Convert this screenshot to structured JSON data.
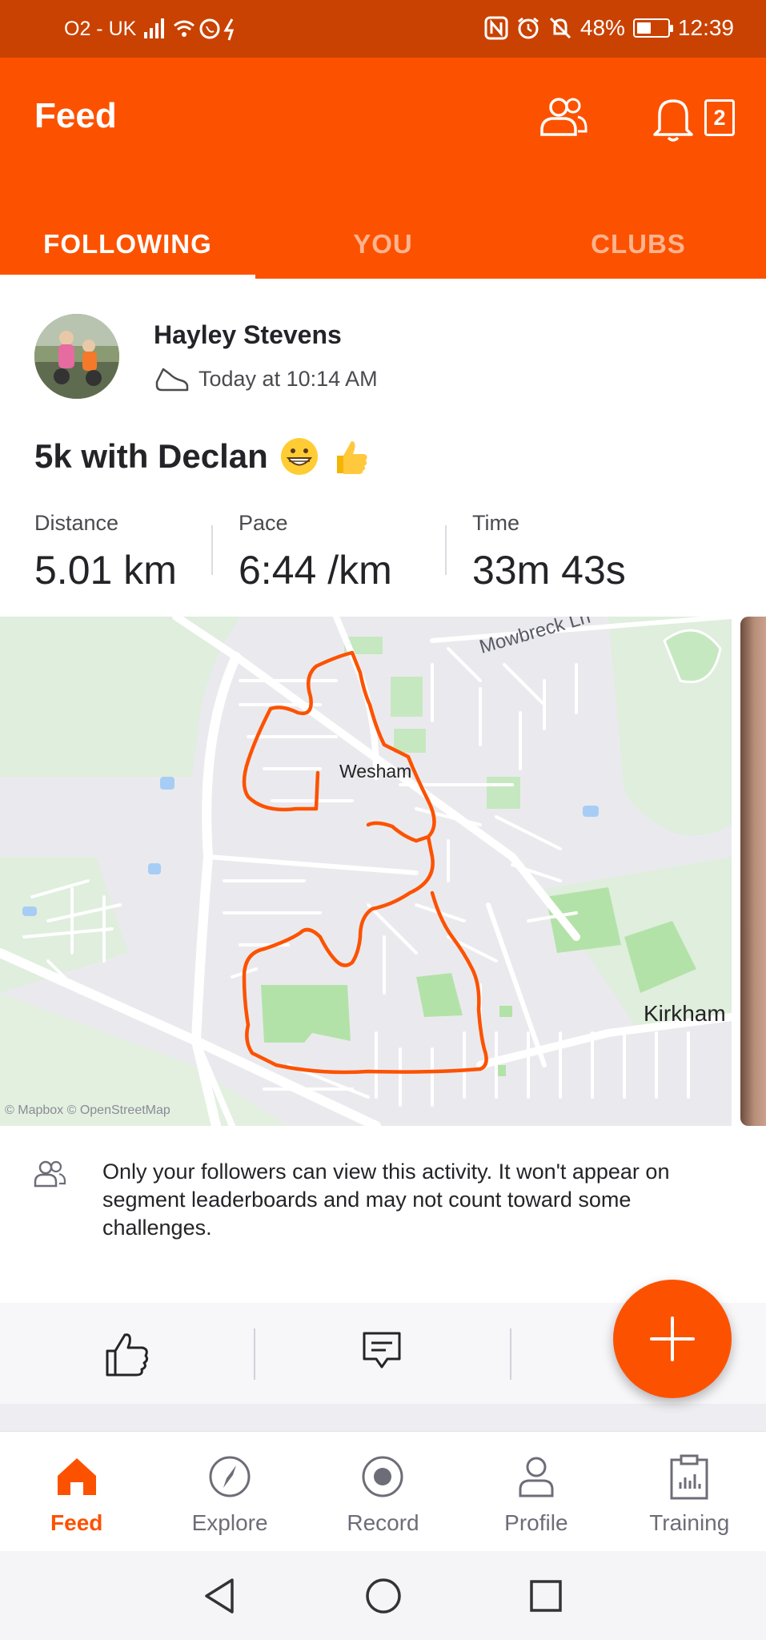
{
  "status_bar": {
    "carrier": "O2 - UK",
    "battery": "48%",
    "battery_level": 0.48,
    "time": "12:39"
  },
  "header": {
    "title": "Feed",
    "notification_count": "2",
    "icons": [
      "people-icon",
      "bell-icon"
    ]
  },
  "tabs": [
    {
      "label": "FOLLOWING",
      "active": true
    },
    {
      "label": "YOU",
      "active": false
    },
    {
      "label": "CLUBS",
      "active": false
    }
  ],
  "activity": {
    "athlete": "Hayley Stevens",
    "timestamp": "Today at 10:14 AM",
    "title": "5k with Declan",
    "title_emojis": [
      "grinning-face",
      "thumbs-up"
    ],
    "stats": [
      {
        "label": "Distance",
        "value": "5.01 km"
      },
      {
        "label": "Pace",
        "value": "6:44 /km"
      },
      {
        "label": "Time",
        "value": "33m 43s"
      }
    ],
    "map": {
      "labels": {
        "town": "Wesham",
        "road": "Mowbreck Ln",
        "place": "Kirkham"
      },
      "attribution": "© Mapbox © OpenStreetMap",
      "route_color": "#fc5200"
    },
    "privacy_note": "Only your followers can view this activity. It won't appear on segment leaderboards and may not count toward some challenges."
  },
  "actions": [
    "thumbs-up-icon",
    "comment-icon",
    "share-icon"
  ],
  "fab": {
    "icon": "plus-icon"
  },
  "bottom_nav": [
    {
      "label": "Feed",
      "icon": "home-icon",
      "active": true
    },
    {
      "label": "Explore",
      "icon": "compass-icon",
      "active": false
    },
    {
      "label": "Record",
      "icon": "record-icon",
      "active": false
    },
    {
      "label": "Profile",
      "icon": "profile-icon",
      "active": false
    },
    {
      "label": "Training",
      "icon": "clipboard-icon",
      "active": false
    }
  ],
  "colors": {
    "brand": "#fc5200",
    "status_bar": "#c94202"
  }
}
